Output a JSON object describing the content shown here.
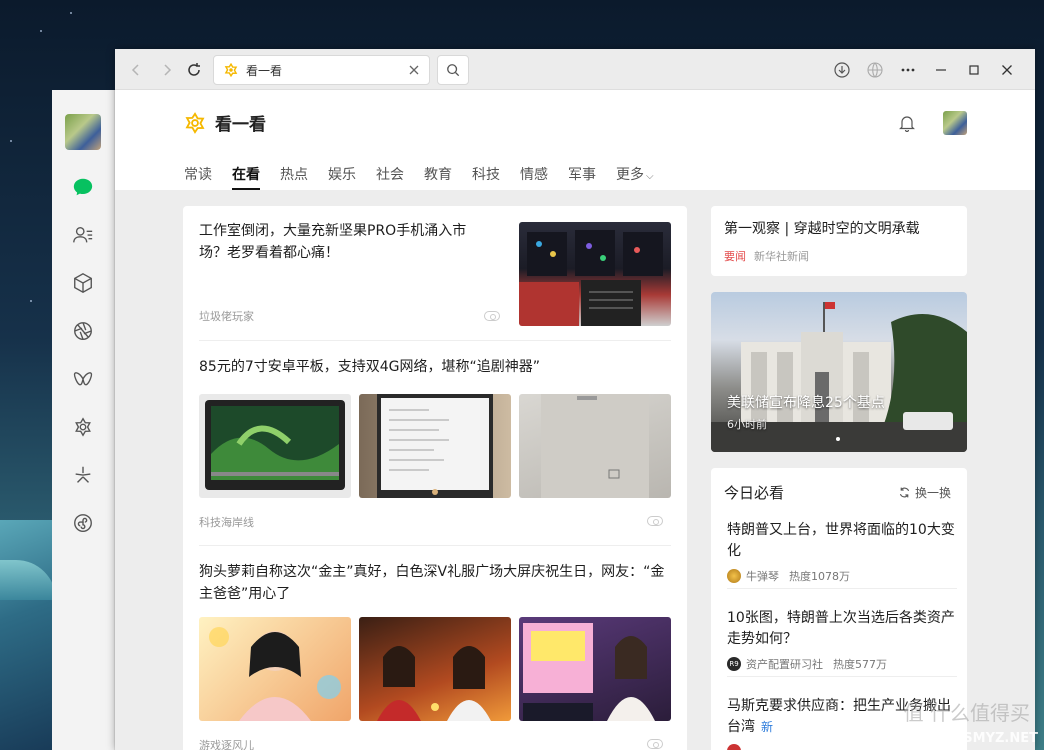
{
  "window": {
    "tab_title": "看一看"
  },
  "header": {
    "brand": "看一看",
    "tabs": [
      {
        "label": "常读",
        "active": false
      },
      {
        "label": "在看",
        "active": true
      },
      {
        "label": "热点",
        "active": false
      },
      {
        "label": "娱乐",
        "active": false
      },
      {
        "label": "社会",
        "active": false
      },
      {
        "label": "教育",
        "active": false
      },
      {
        "label": "科技",
        "active": false
      },
      {
        "label": "情感",
        "active": false
      },
      {
        "label": "军事",
        "active": false
      },
      {
        "label": "更多",
        "active": false
      }
    ]
  },
  "feed": [
    {
      "title": "工作室倒闭，大量充新坚果PRO手机涌入市场？老罗看着都心痛！",
      "source": "垃圾佬玩家"
    },
    {
      "title": "85元的7寸安卓平板，支持双4G网络，堪称“追剧神器”",
      "source": "科技海岸线"
    },
    {
      "title": "狗头萝莉自称这次“金主”真好，白色深V礼服广场大屏庆祝生日，网友：“金主爸爸”用心了",
      "source": "游戏逐风儿"
    }
  ],
  "side": {
    "top_card": {
      "title": "第一观察 | 穿越时空的文明承载",
      "tag": "要闻",
      "source": "新华社新闻"
    },
    "banner": {
      "title": "美联储宣布降息25个基点",
      "time": "6小时前"
    },
    "must_read": {
      "title": "今日必看",
      "refresh": "换一换",
      "items": [
        {
          "title": "特朗普又上台，世界将面临的10大变化",
          "author": "牛弹琴",
          "heat": "热度1078万"
        },
        {
          "title": "10张图，特朗普上次当选后各类资产走势如何？",
          "author": "资产配置研习社",
          "heat": "热度577万"
        },
        {
          "title": "马斯克要求供应商：把生产业务搬出台湾",
          "badge": "新",
          "author": "",
          "heat": ""
        }
      ]
    }
  },
  "watermark": {
    "cn": "值 什么值得买",
    "en": "SMYZ.NET"
  },
  "colors": {
    "accent_green": "#07c160",
    "brand_yellow": "#f5b800",
    "tag_red": "#e34b4b",
    "new_blue": "#2b7bdb"
  }
}
